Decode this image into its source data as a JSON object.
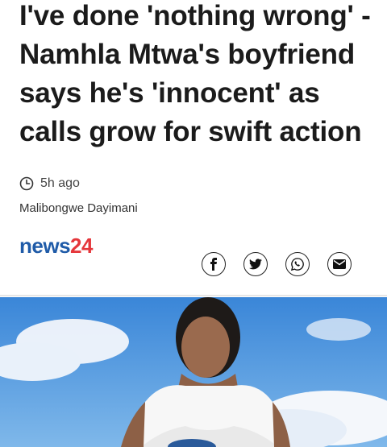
{
  "article": {
    "headline": "I've done 'nothing wrong' - Namhla Mtwa's boyfriend says he's 'innocent' as calls grow for swift action",
    "time_ago": "5h ago",
    "author": "Malibongwe Dayimani"
  },
  "brand": {
    "logo_part1": "news",
    "logo_part2": "24",
    "colors": {
      "news": "#1f5ba8",
      "num": "#e5363b"
    }
  },
  "share": {
    "icons": [
      "facebook-icon",
      "twitter-icon",
      "whatsapp-icon",
      "email-icon"
    ]
  }
}
